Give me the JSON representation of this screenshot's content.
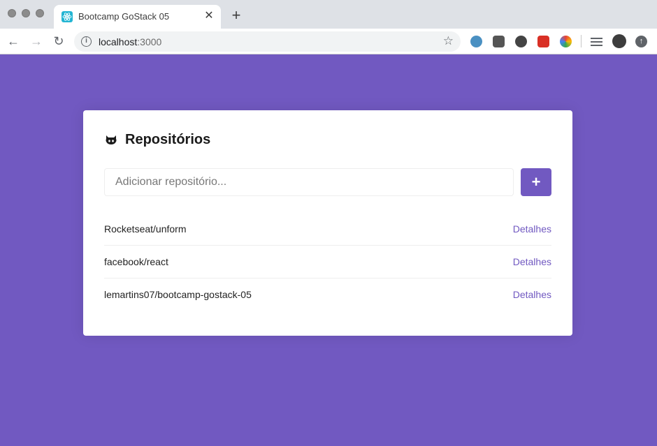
{
  "browser": {
    "tab_title": "Bootcamp GoStack 05",
    "tab_close": "✕",
    "new_tab": "+",
    "url_host": "localhost",
    "url_port": ":3000"
  },
  "page": {
    "title": "Repositórios",
    "input_placeholder": "Adicionar repositório...",
    "add_button_label": "+",
    "repositories": [
      {
        "name": "Rocketseat/unform",
        "link": "Detalhes"
      },
      {
        "name": "facebook/react",
        "link": "Detalhes"
      },
      {
        "name": "lemartins07/bootcamp-gostack-05",
        "link": "Detalhes"
      }
    ]
  },
  "colors": {
    "background": "#7159c1",
    "accent": "#7159c1"
  }
}
